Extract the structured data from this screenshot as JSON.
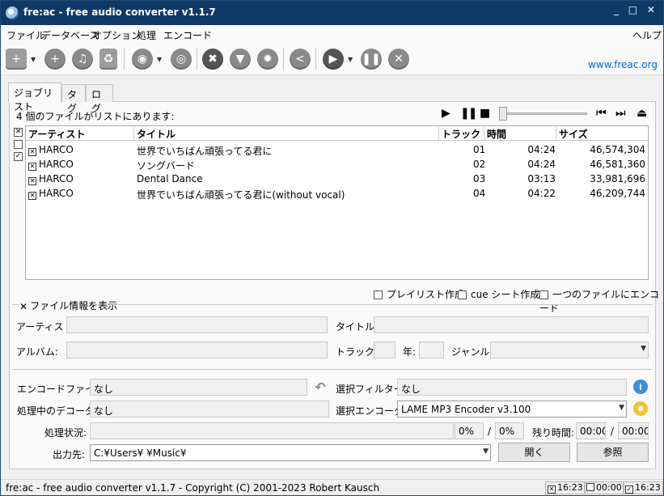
{
  "window": {
    "title": "fre:ac - free audio converter v1.1.7",
    "controls": "_ □ ✕"
  },
  "menu": {
    "items": [
      "ファイル",
      "データベース",
      "オプション",
      "処理",
      "エンコード"
    ],
    "help": "ヘルプ"
  },
  "toolbar": {
    "site_link": "www.freac.org"
  },
  "tabs": [
    "ジョブリスト",
    "タグ",
    "ログ"
  ],
  "joblist": {
    "count_text": "4 個のファイルがリストにあります:",
    "headers": {
      "artist": "アーティスト",
      "title": "タイトル",
      "track": "トラック",
      "time": "時間",
      "size": "サイズ"
    },
    "rows": [
      {
        "checked": true,
        "artist": "HARCO",
        "title": "世界でいちばん頑張ってる君に",
        "track": "01",
        "time": "04:24",
        "size": "46,574,304"
      },
      {
        "checked": true,
        "artist": "HARCO",
        "title": "ソングバード",
        "track": "02",
        "time": "04:24",
        "size": "46,581,360"
      },
      {
        "checked": true,
        "artist": "HARCO",
        "title": "Dental Dance",
        "track": "03",
        "time": "03:13",
        "size": "33,981,696"
      },
      {
        "checked": true,
        "artist": "HARCO",
        "title": "世界でいちばん頑張ってる君に(without vocal)",
        "track": "04",
        "time": "04:22",
        "size": "46,209,744"
      }
    ],
    "options": {
      "playlist": "プレイリスト作成",
      "cue": "cue シート作成",
      "single_file": "一つのファイルにエンコード"
    }
  },
  "fileinfo": {
    "toggle": "ファイル情報を表示",
    "artist": "アーティスト:",
    "title": "タイトル:",
    "album": "アルバム:",
    "track": "トラック:",
    "year": "年:",
    "genre": "ジャンル:"
  },
  "encode": {
    "file_label": "エンコードファイル:",
    "file_value": "なし",
    "decoder_label": "処理中のデコーダ:",
    "decoder_value": "なし",
    "filter_label": "選択フィルター:",
    "filter_value": "なし",
    "encoder_label": "選択エンコーダ:",
    "encoder_value": "LAME MP3 Encoder v3.100",
    "status_label": "処理状況:",
    "progress_file": "0%",
    "slash1": "/",
    "progress_total": "0%",
    "remaining_label": "残り時間:",
    "remaining_file": "00:00",
    "slash2": "/",
    "remaining_total": "00:00",
    "output_label": "出力先:",
    "output_value": "C:¥Users¥        ¥Music¥",
    "open_button": "開く",
    "browse_button": "参照"
  },
  "statusbar": {
    "text": "fre:ac - free audio converter v1.1.7 - Copyright (C) 2001-2023 Robert Kausch",
    "cells": [
      "16:23",
      "00:00",
      "16:23"
    ]
  },
  "colors": {
    "titlebar": "#0f3a67",
    "link": "#0066cc"
  }
}
